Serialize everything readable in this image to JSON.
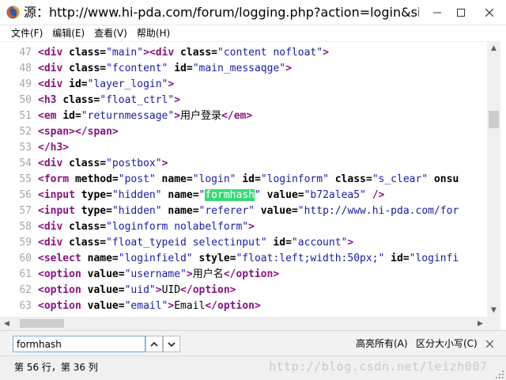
{
  "window": {
    "title": "源：http://www.hi-pda.com/forum/logging.php?action=login&sid..."
  },
  "menu": {
    "items": [
      {
        "label": "文件(F)"
      },
      {
        "label": "编辑(E)"
      },
      {
        "label": "查看(V)"
      },
      {
        "label": "帮助(H)"
      }
    ]
  },
  "source": {
    "lines": [
      {
        "num": "47",
        "tokens": [
          [
            "tag",
            "<div "
          ],
          [
            "attr",
            "class="
          ],
          [
            "val",
            "\"main\""
          ],
          [
            "tag",
            ">"
          ],
          [
            "tag",
            "<div "
          ],
          [
            "attr",
            "class="
          ],
          [
            "val",
            "\"content nofloat\""
          ],
          [
            "tag",
            ">"
          ]
        ]
      },
      {
        "num": "48",
        "tokens": [
          [
            "tag",
            "<div "
          ],
          [
            "attr",
            "class="
          ],
          [
            "val",
            "\"fcontent\""
          ],
          [
            "attr",
            " id="
          ],
          [
            "val",
            "\"main_messaqge\""
          ],
          [
            "tag",
            ">"
          ]
        ]
      },
      {
        "num": "49",
        "tokens": [
          [
            "tag",
            "<div "
          ],
          [
            "attr",
            "id="
          ],
          [
            "val",
            "\"layer_login\""
          ],
          [
            "tag",
            ">"
          ]
        ]
      },
      {
        "num": "50",
        "tokens": [
          [
            "tag",
            "<h3 "
          ],
          [
            "attr",
            "class="
          ],
          [
            "val",
            "\"float_ctrl\""
          ],
          [
            "tag",
            ">"
          ]
        ]
      },
      {
        "num": "51",
        "tokens": [
          [
            "tag",
            "<em "
          ],
          [
            "attr",
            "id="
          ],
          [
            "val",
            "\"returnmessage\""
          ],
          [
            "tag",
            ">"
          ],
          [
            "text",
            "用户登录"
          ],
          [
            "tag",
            "</em>"
          ]
        ]
      },
      {
        "num": "52",
        "tokens": [
          [
            "tag",
            "<span>"
          ],
          [
            "tag",
            "</span>"
          ]
        ]
      },
      {
        "num": "53",
        "tokens": [
          [
            "tag",
            "</h3>"
          ]
        ]
      },
      {
        "num": "54",
        "tokens": [
          [
            "tag",
            "<div "
          ],
          [
            "attr",
            "class="
          ],
          [
            "val",
            "\"postbox\""
          ],
          [
            "tag",
            ">"
          ]
        ]
      },
      {
        "num": "55",
        "tokens": [
          [
            "tag",
            "<form "
          ],
          [
            "attr",
            "method="
          ],
          [
            "val",
            "\"post\""
          ],
          [
            "attr",
            " name="
          ],
          [
            "val",
            "\"login\""
          ],
          [
            "attr",
            " id="
          ],
          [
            "val",
            "\"loginform\""
          ],
          [
            "attr",
            " class="
          ],
          [
            "val",
            "\"s_clear\""
          ],
          [
            "attr",
            " onsu"
          ]
        ]
      },
      {
        "num": "56",
        "tokens": [
          [
            "tag",
            "<input "
          ],
          [
            "attr",
            "type="
          ],
          [
            "val",
            "\"hidden\""
          ],
          [
            "attr",
            " name="
          ],
          [
            "val",
            "\""
          ],
          [
            "hl",
            "formhash"
          ],
          [
            "val",
            "\""
          ],
          [
            "attr",
            " value="
          ],
          [
            "val",
            "\"b72alea5\""
          ],
          [
            "tag",
            " />"
          ]
        ]
      },
      {
        "num": "57",
        "tokens": [
          [
            "tag",
            "<input "
          ],
          [
            "attr",
            "type="
          ],
          [
            "val",
            "\"hidden\""
          ],
          [
            "attr",
            " name="
          ],
          [
            "val",
            "\"referer\""
          ],
          [
            "attr",
            " value="
          ],
          [
            "val",
            "\"http://www.hi-pda.com/for"
          ]
        ]
      },
      {
        "num": "58",
        "tokens": [
          [
            "tag",
            "<div "
          ],
          [
            "attr",
            "class="
          ],
          [
            "val",
            "\"loginform nolabelform\""
          ],
          [
            "tag",
            ">"
          ]
        ]
      },
      {
        "num": "59",
        "tokens": [
          [
            "tag",
            "<div "
          ],
          [
            "attr",
            "class="
          ],
          [
            "val",
            "\"float_typeid selectinput\""
          ],
          [
            "attr",
            " id="
          ],
          [
            "val",
            "\"account\""
          ],
          [
            "tag",
            ">"
          ]
        ]
      },
      {
        "num": "60",
        "tokens": [
          [
            "tag",
            "<select "
          ],
          [
            "attr",
            "name="
          ],
          [
            "val",
            "\"loginfield\""
          ],
          [
            "attr",
            " style="
          ],
          [
            "val",
            "\"float:left;width:50px;\""
          ],
          [
            "attr",
            " id="
          ],
          [
            "val",
            "\"loginfi"
          ]
        ]
      },
      {
        "num": "61",
        "tokens": [
          [
            "tag",
            "<option "
          ],
          [
            "attr",
            "value="
          ],
          [
            "val",
            "\"username\""
          ],
          [
            "tag",
            ">"
          ],
          [
            "text",
            "用户名"
          ],
          [
            "tag",
            "</option>"
          ]
        ]
      },
      {
        "num": "62",
        "tokens": [
          [
            "tag",
            "<option "
          ],
          [
            "attr",
            "value="
          ],
          [
            "val",
            "\"uid\""
          ],
          [
            "tag",
            ">"
          ],
          [
            "text",
            "UID"
          ],
          [
            "tag",
            "</option>"
          ]
        ]
      },
      {
        "num": "63",
        "tokens": [
          [
            "tag",
            "<option "
          ],
          [
            "attr",
            "value="
          ],
          [
            "val",
            "\"email\""
          ],
          [
            "tag",
            ">"
          ],
          [
            "text",
            "Email"
          ],
          [
            "tag",
            "</option>"
          ]
        ]
      }
    ]
  },
  "find": {
    "query": "formhash",
    "highlight_all_label": "高亮所有(A)",
    "match_case_label": "区分大小写(C)"
  },
  "status": {
    "position": "第 56 行，第 36 列",
    "watermark": "http://blog.csdn.net/leizh007"
  },
  "colors": {
    "tag": "#881280",
    "value": "#1a1aa6",
    "line_number": "#a6a6a6",
    "highlight": "#38d878"
  }
}
